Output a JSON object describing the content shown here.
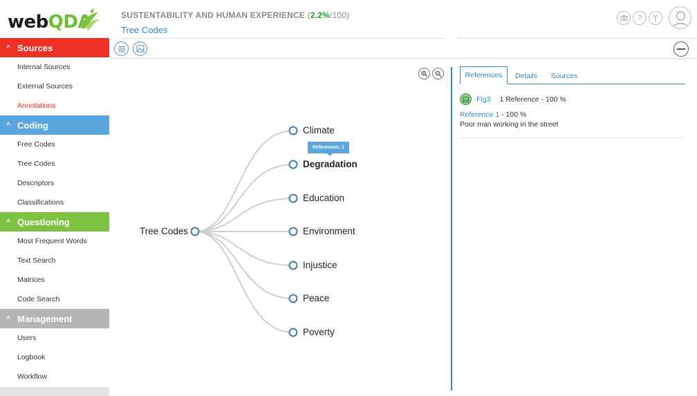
{
  "app": {
    "logo_main": "web",
    "logo_accent": "QDA"
  },
  "header": {
    "project_title": "SUSTENTABILITY AND HUMAN EXPERIENCE",
    "progress_open": "(",
    "progress_value": "2.2%",
    "progress_total": "/100)",
    "subtitle": "Tree Codes",
    "icons": [
      "camera-icon",
      "help-icon",
      "settings-icon",
      "user-avatar-icon"
    ]
  },
  "sidebar": {
    "sections": [
      {
        "label": "Sources",
        "color": "#ee3124",
        "items": [
          "Internal Sources",
          "External Sources",
          "Annotations"
        ],
        "active_item": "Annotations"
      },
      {
        "label": "Coding",
        "color": "#5aa7e0",
        "items": [
          "Free Codes",
          "Tree Codes",
          "Descriptors",
          "Classifications"
        ]
      },
      {
        "label": "Questioning",
        "color": "#7dc242",
        "items": [
          "Most Frequent Words",
          "Text Search",
          "Matrices",
          "Code Search"
        ]
      },
      {
        "label": "Management",
        "color": "#b4b4b4",
        "items": [
          "Users",
          "Logbook",
          "Workflow"
        ]
      }
    ]
  },
  "toolbar": {
    "icons": [
      "list-view-icon",
      "image-view-icon"
    ],
    "collapse_icon": "minus-icon"
  },
  "zoom": {
    "icons": [
      "zoom-in-icon",
      "zoom-out-icon"
    ]
  },
  "tree": {
    "root": "Tree Codes",
    "children": [
      "Climate",
      "Degradation",
      "Education",
      "Environment",
      "Injustice",
      "Peace",
      "Poverty"
    ],
    "highlighted": "Degradation",
    "tooltip": "References: 1"
  },
  "right_panel": {
    "tabs": [
      "References",
      "Details",
      "Sources"
    ],
    "active_tab": "References",
    "source_name": "Fig3",
    "reference_summary": "1 Reference - 100 %",
    "reference_label": "Reference 1",
    "reference_pct": " - 100 %",
    "reference_text": "Poor man working in the street"
  },
  "colors": {
    "accent_blue": "#2e86c8",
    "sources_red": "#ee3124",
    "coding_blue": "#5aa7e0",
    "questioning_green": "#7dc242",
    "management_grey": "#b4b4b4"
  }
}
